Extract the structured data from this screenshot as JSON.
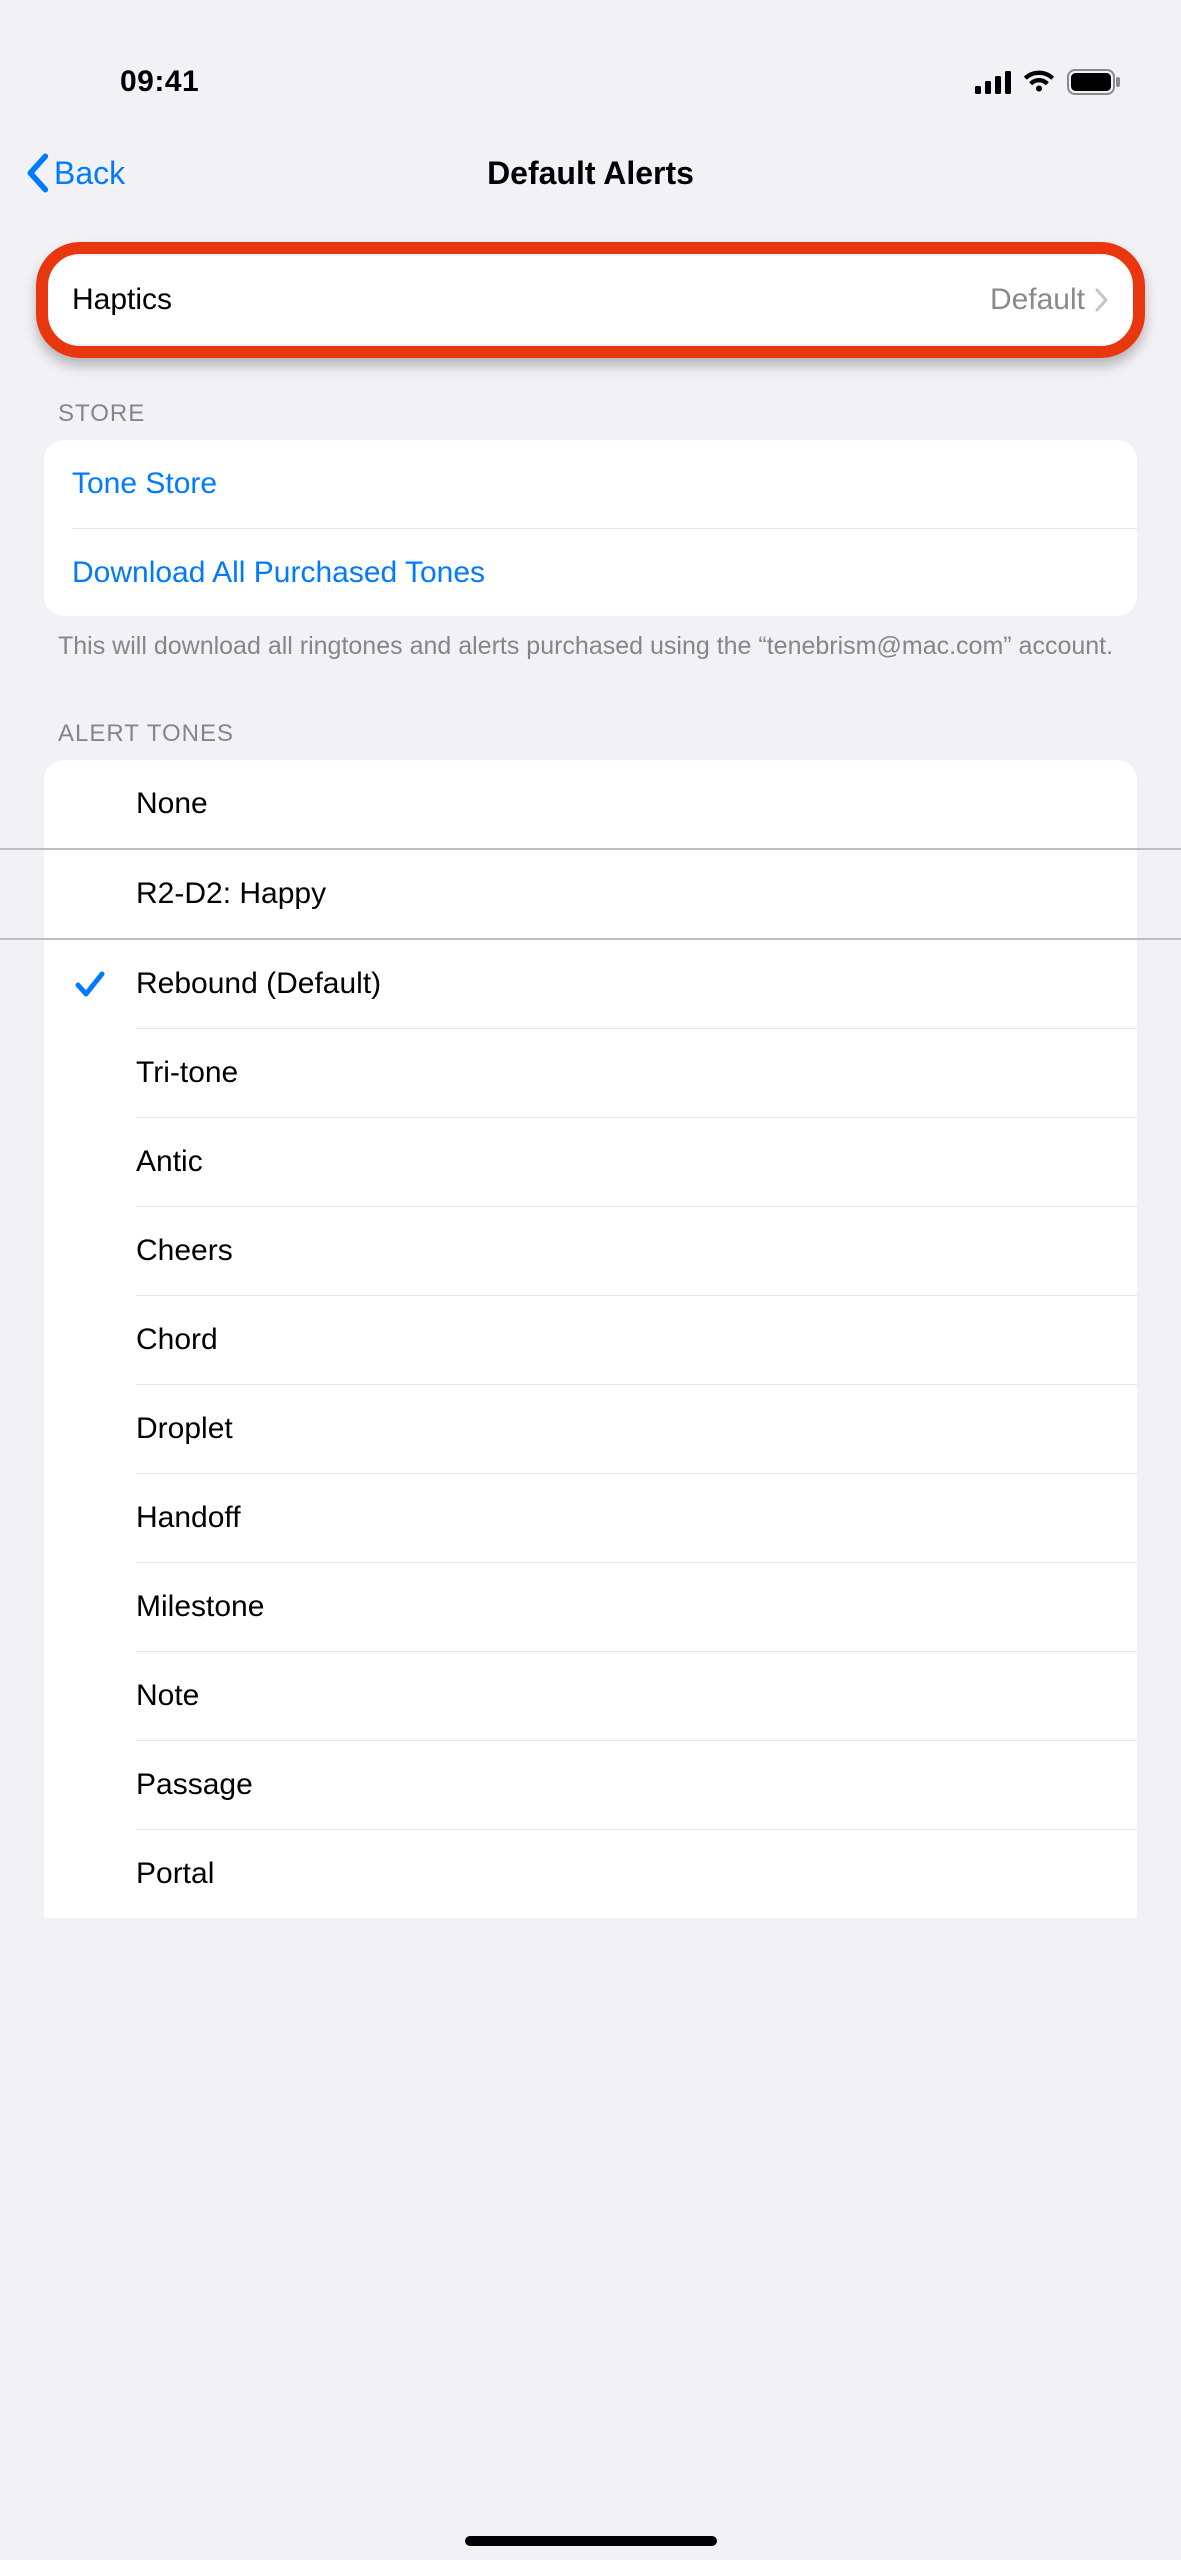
{
  "status": {
    "time": "09:41"
  },
  "nav": {
    "back": "Back",
    "title": "Default Alerts"
  },
  "haptics": {
    "label": "Haptics",
    "value": "Default"
  },
  "store": {
    "header": "STORE",
    "tone_store": "Tone Store",
    "download_all": "Download All Purchased Tones",
    "footer": "This will download all ringtones and alerts purchased using the “tenebrism@mac.com” account."
  },
  "alert_tones": {
    "header": "ALERT TONES",
    "items": [
      {
        "name": "None",
        "selected": false,
        "sep": "full"
      },
      {
        "name": "R2-D2: Happy",
        "selected": false,
        "sep": "full"
      },
      {
        "name": "Rebound (Default)",
        "selected": true,
        "sep": "inset"
      },
      {
        "name": "Tri-tone",
        "selected": false,
        "sep": "inset"
      },
      {
        "name": "Antic",
        "selected": false,
        "sep": "inset"
      },
      {
        "name": "Cheers",
        "selected": false,
        "sep": "inset"
      },
      {
        "name": "Chord",
        "selected": false,
        "sep": "inset"
      },
      {
        "name": "Droplet",
        "selected": false,
        "sep": "inset"
      },
      {
        "name": "Handoff",
        "selected": false,
        "sep": "inset"
      },
      {
        "name": "Milestone",
        "selected": false,
        "sep": "inset"
      },
      {
        "name": "Note",
        "selected": false,
        "sep": "inset"
      },
      {
        "name": "Passage",
        "selected": false,
        "sep": "inset"
      },
      {
        "name": "Portal",
        "selected": false,
        "sep": "none"
      }
    ]
  }
}
